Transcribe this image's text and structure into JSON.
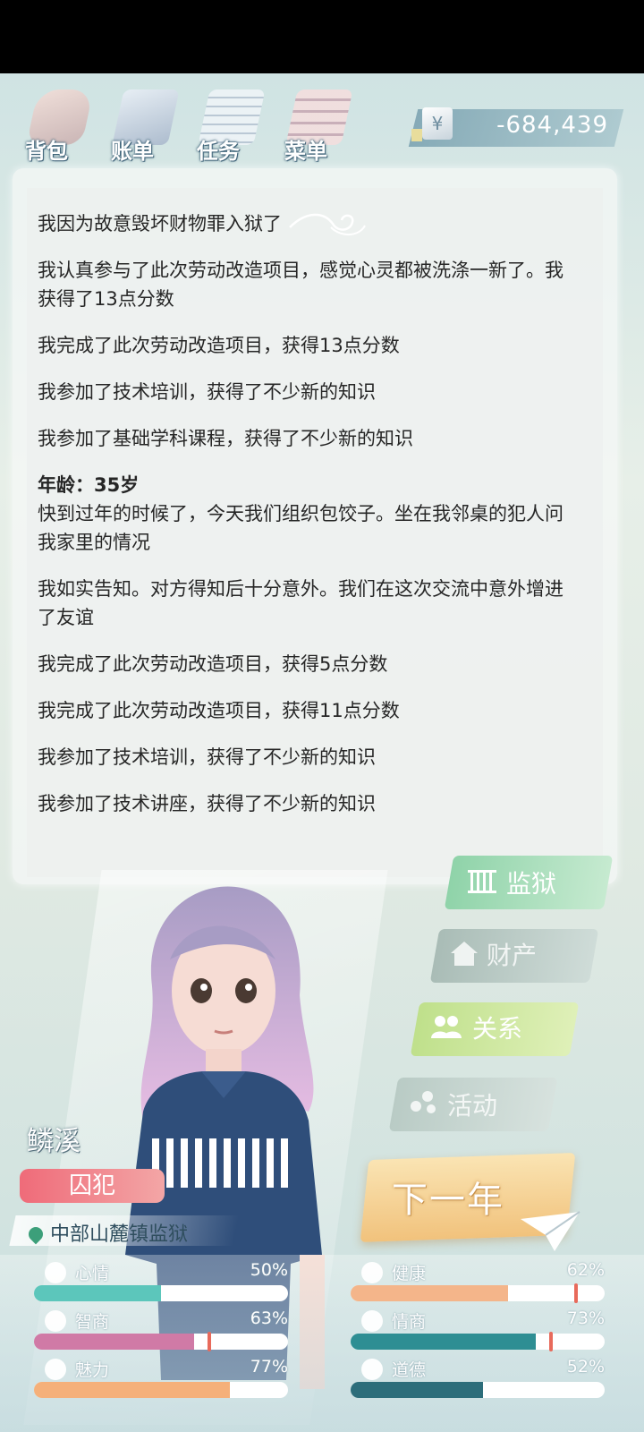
{
  "topbar": {
    "buttons": [
      {
        "label": "背包",
        "icon": "backpack-icon"
      },
      {
        "label": "账单",
        "icon": "bill-icon"
      },
      {
        "label": "任务",
        "icon": "task-icon"
      },
      {
        "label": "菜单",
        "icon": "menu-icon"
      }
    ],
    "currency_symbol": "¥",
    "money": "-684,439"
  },
  "log": [
    {
      "text": "我因为故意毁坏财物罪入狱了"
    },
    {
      "text": "我认真参与了此次劳动改造项目，感觉心灵都被洗涤一新了。我获得了13点分数"
    },
    {
      "text": "我完成了此次劳动改造项目，获得13点分数"
    },
    {
      "text": "我参加了技术培训，获得了不少新的知识"
    },
    {
      "text": "我参加了基础学科课程，获得了不少新的知识"
    },
    {
      "text": "年龄：35岁",
      "age": true
    },
    {
      "text": "快到过年的时候了，今天我们组织包饺子。坐在我邻桌的犯人问我家里的情况"
    },
    {
      "text": "我如实告知。对方得知后十分意外。我们在这次交流中意外增进了友谊"
    },
    {
      "text": "我完成了此次劳动改造项目，获得5点分数"
    },
    {
      "text": "我完成了此次劳动改造项目，获得11点分数"
    },
    {
      "text": "我参加了技术培训，获得了不少新的知识"
    },
    {
      "text": "我参加了技术讲座，获得了不少新的知识"
    }
  ],
  "character": {
    "name": "鳞溪",
    "role": "囚犯",
    "location": "中部山麓镇监狱"
  },
  "side_menu": [
    {
      "label": "监狱",
      "icon": "prison-icon",
      "enabled": true,
      "color": "#9ed9b4"
    },
    {
      "label": "财产",
      "icon": "house-icon",
      "enabled": false,
      "color": "#b7c7c2"
    },
    {
      "label": "关系",
      "icon": "people-icon",
      "enabled": true,
      "color": "#c7e58f"
    },
    {
      "label": "活动",
      "icon": "activity-icon",
      "enabled": false,
      "color": "#c3d2cd"
    }
  ],
  "next_year_label": "下一年",
  "stats": [
    {
      "name": "心情",
      "value": "50%",
      "fraction": 0.5,
      "color": "#5cc6bb",
      "icon": "smile-icon"
    },
    {
      "name": "健康",
      "value": "62%",
      "fraction": 0.62,
      "color": "#f4b58a",
      "icon": "heart-icon"
    },
    {
      "name": "智商",
      "value": "63%",
      "fraction": 0.63,
      "color": "#d07aa6",
      "icon": "bulb-icon"
    },
    {
      "name": "情商",
      "value": "73%",
      "fraction": 0.73,
      "color": "#2e8e93",
      "icon": "apple-icon"
    },
    {
      "name": "魅力",
      "value": "77%",
      "fraction": 0.77,
      "color": "#f5b07a",
      "icon": "sparkle-icon"
    },
    {
      "name": "道德",
      "value": "52%",
      "fraction": 0.52,
      "color": "#2c6d7a",
      "icon": "scale-icon"
    }
  ]
}
